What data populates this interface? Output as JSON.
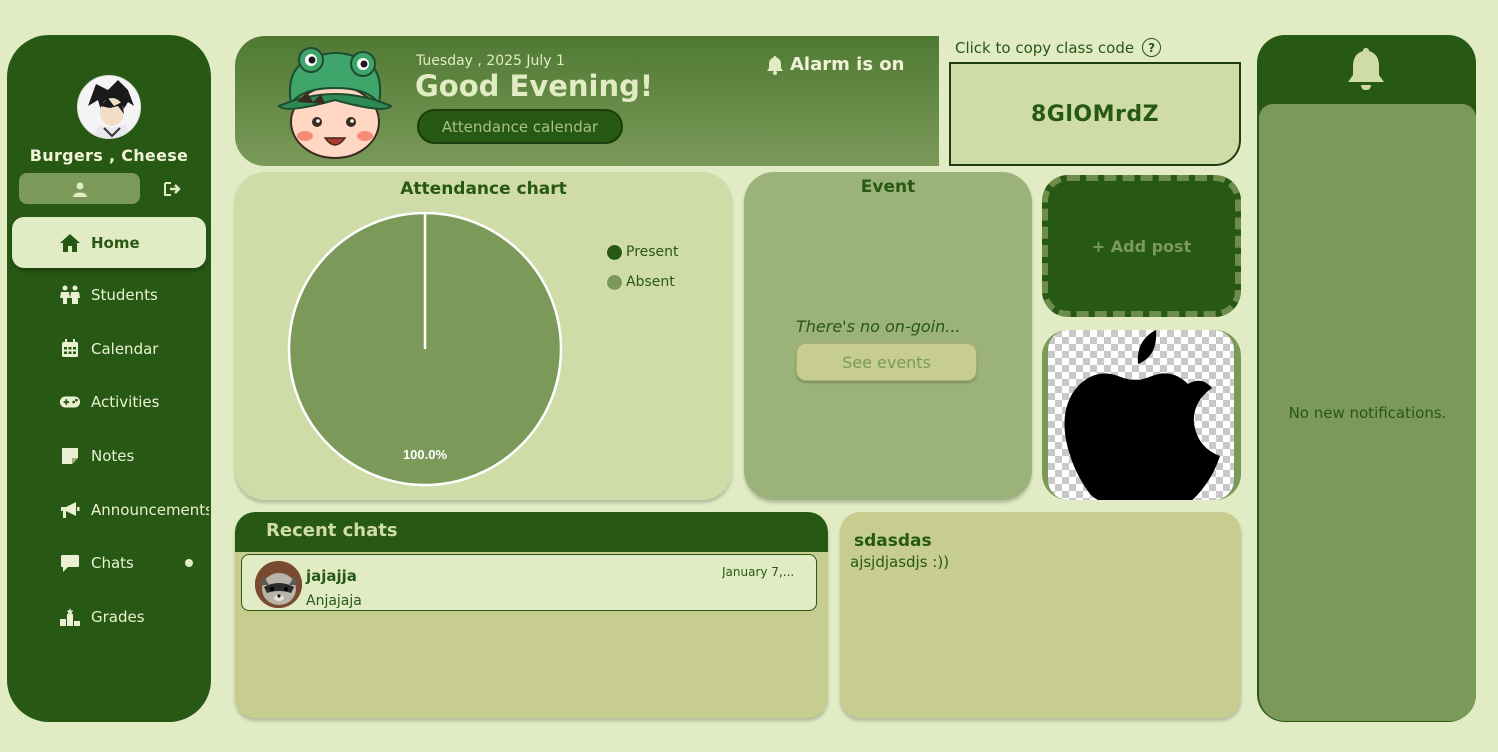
{
  "sidebar": {
    "user_name": "Burgers , Cheese",
    "items": [
      {
        "label": "Home",
        "icon": "home-icon"
      },
      {
        "label": "Students",
        "icon": "students-icon"
      },
      {
        "label": "Calendar",
        "icon": "calendar-icon"
      },
      {
        "label": "Activities",
        "icon": "gamepad-icon"
      },
      {
        "label": "Notes",
        "icon": "note-icon"
      },
      {
        "label": "Announcements",
        "icon": "megaphone-icon"
      },
      {
        "label": "Chats",
        "icon": "chat-icon"
      },
      {
        "label": "Grades",
        "icon": "podium-icon"
      }
    ]
  },
  "header": {
    "date": "Tuesday , 2025 July 1",
    "greeting": "Good Evening!",
    "attendance_calendar_label": "Attendance calendar",
    "alarm_label": "Alarm is on"
  },
  "class_code": {
    "label": "Click to copy class code",
    "help": "?",
    "code": "8GlOMrdZ"
  },
  "attendance": {
    "title": "Attendance chart",
    "legend": [
      {
        "label": "Present",
        "color": "#275814"
      },
      {
        "label": "Absent",
        "color": "#7b9a59"
      }
    ]
  },
  "chart_data": {
    "type": "pie",
    "title": "Attendance chart",
    "labels": [
      "Present",
      "Absent"
    ],
    "values": [
      0,
      100
    ],
    "data_labels": [
      "",
      "100.0%"
    ],
    "colors": [
      "#275814",
      "#7b9a59"
    ],
    "legend": "top-right"
  },
  "event": {
    "title": "Event",
    "message": "There's no on-goin...",
    "see_events_label": "See events"
  },
  "add_post_label": "+ Add post",
  "recent_chats": {
    "title": "Recent chats",
    "items": [
      {
        "name": "jajajja",
        "date": "January 7,...",
        "message": "Anjajaja"
      }
    ]
  },
  "post": {
    "title": "sdasdas",
    "body": "ajsjdjasdjs :))"
  },
  "notifications": {
    "empty_text": "No new notifications."
  },
  "colors": {
    "dark_green": "#275814",
    "mid_green": "#7b9a59",
    "light_green": "#cfdca7",
    "background": "#e1ebc4"
  }
}
